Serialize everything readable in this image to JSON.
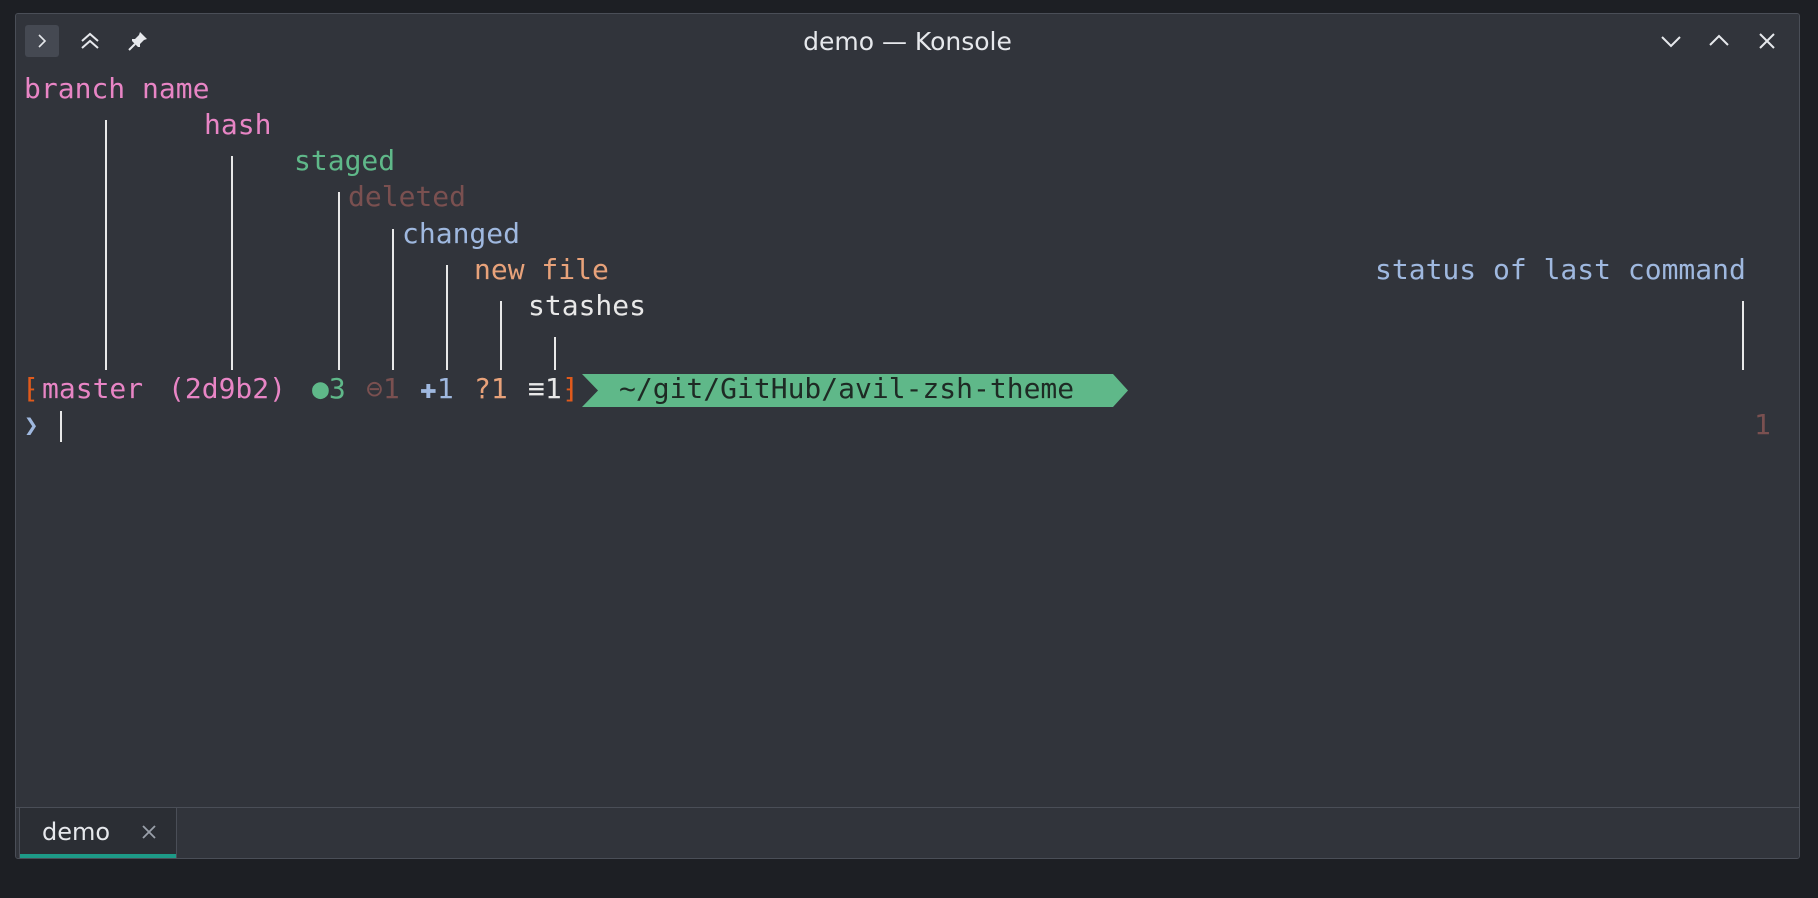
{
  "window": {
    "title": "demo — Konsole"
  },
  "titlebar": {
    "app_icon": "terminal-icon",
    "keep_above_icon": "double-chevron-up-icon",
    "pin_icon": "pin-icon",
    "minimize_icon": "chevron-down-icon",
    "maximize_icon": "chevron-up-icon",
    "close_icon": "close-icon"
  },
  "annotations": {
    "branch_name": "branch name",
    "hash": "hash",
    "staged": "staged",
    "deleted": "deleted",
    "changed": "changed",
    "new_file": "new file",
    "stashes": "stashes",
    "status": "status of last command"
  },
  "prompt": {
    "open_bracket": "⁅",
    "branch": "master",
    "hash": "(2d9b2)",
    "staged": "●3",
    "deleted": "⊖1",
    "changed": "✚1",
    "new_file": "?1",
    "stashes": "≡1",
    "close_bracket": "⁆",
    "path": "~/git/GitHub/avil-zsh-theme",
    "input_marker": "❯",
    "last_status": "1"
  },
  "tabs": [
    {
      "label": "demo",
      "close_icon": "close-icon"
    }
  ],
  "colors": {
    "background": "#31343b",
    "branch": "#e885c5",
    "staged": "#5fb889",
    "deleted": "#7a5050",
    "changed": "#9fb8df",
    "new_file": "#e8a27a",
    "stashes": "#e8e8e8",
    "bracket": "#e05a1c",
    "path_bg": "#5fb889",
    "tab_accent": "#1d9a87"
  }
}
